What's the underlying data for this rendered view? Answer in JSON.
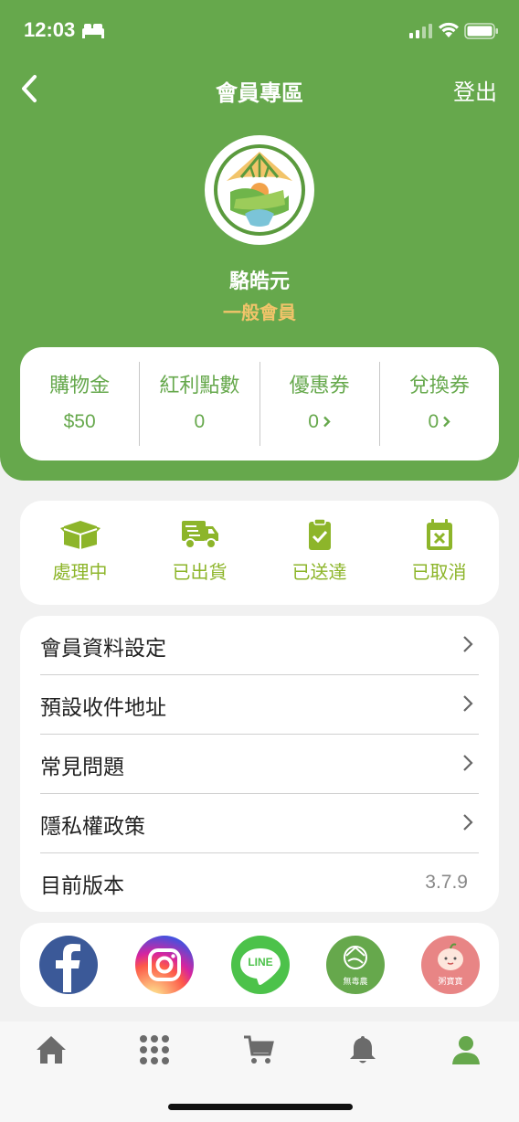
{
  "status_bar": {
    "time": "12:03"
  },
  "nav": {
    "title": "會員專區",
    "logout_label": "登出"
  },
  "profile": {
    "name": "駱皓元",
    "level": "一般會員"
  },
  "stats": [
    {
      "label": "購物金",
      "value": "$50"
    },
    {
      "label": "紅利點數",
      "value": "0"
    },
    {
      "label": "優惠券",
      "value": "0"
    },
    {
      "label": "兌換券",
      "value": "0"
    }
  ],
  "orders": [
    {
      "label": "處理中",
      "icon": "box-icon"
    },
    {
      "label": "已出貨",
      "icon": "truck-icon"
    },
    {
      "label": "已送達",
      "icon": "clipboard-check-icon"
    },
    {
      "label": "已取消",
      "icon": "calendar-x-icon"
    }
  ],
  "menu": [
    {
      "label": "會員資料設定"
    },
    {
      "label": "預設收件地址"
    },
    {
      "label": "常見問題"
    },
    {
      "label": "隱私權政策"
    },
    {
      "label": "目前版本",
      "value": "3.7.9"
    }
  ],
  "social": {
    "line_label": "LINE",
    "wdn_caption": "無毒農",
    "zbb_caption": "粥寶寶"
  },
  "colors": {
    "brand_green": "#66a84c",
    "accent_gold": "#f2c46a",
    "order_green": "#8db52a"
  }
}
